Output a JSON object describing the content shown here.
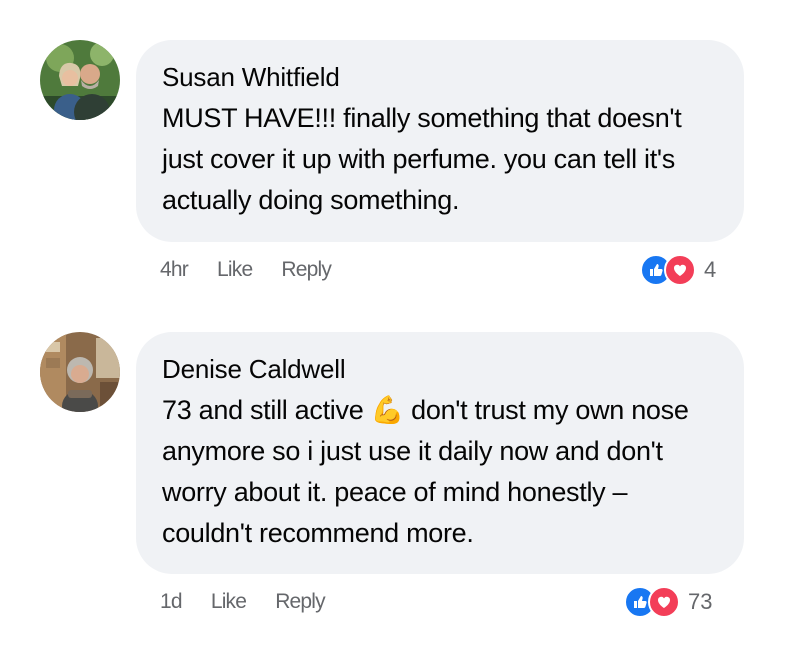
{
  "comments": [
    {
      "author": "Susan Whitfield",
      "text": "MUST HAVE!!! finally something that doesn't just cover it up with perfume. you can tell it's actually doing something.",
      "time": "4hr",
      "like_label": "Like",
      "reply_label": "Reply",
      "reaction_count": "4",
      "reaction_icons": [
        "like-icon",
        "love-icon"
      ]
    },
    {
      "author": "Denise Caldwell",
      "text_part1": "73 and still active ",
      "emoji": "💪",
      "text_part2": " don't trust my own nose anymore so i just use it daily now and don't worry about it. peace of mind honestly – couldn't recommend more.",
      "time": "1d",
      "like_label": "Like",
      "reply_label": "Reply",
      "reaction_count": "73",
      "reaction_icons": [
        "like-icon",
        "love-icon"
      ]
    }
  ],
  "colors": {
    "bubble": "#f0f2f5",
    "meta_text": "#65676b",
    "like_blue": "#1877f2",
    "love_red": "#f33e58"
  }
}
